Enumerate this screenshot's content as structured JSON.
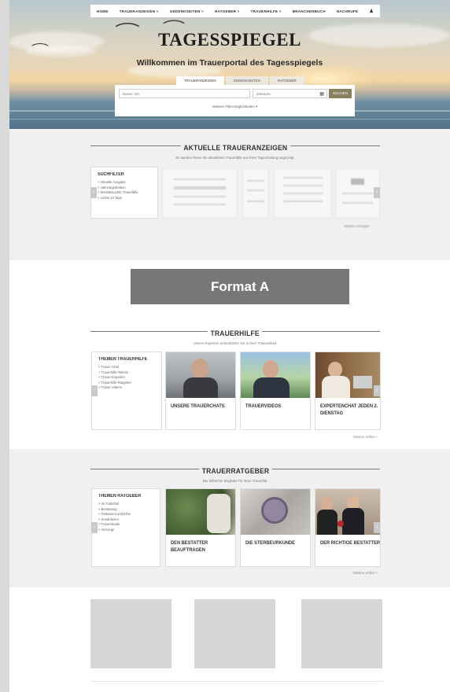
{
  "nav": {
    "items": [
      "HOME",
      "TRAUERANZEIGEN",
      "GEDENKSEITEN",
      "RATGEBER",
      "TRAUERHILFE",
      "BRANCHENBUCH",
      "NACHRUFE"
    ],
    "user_icon": "user-icon"
  },
  "hero": {
    "logo": "TAGESSPIEGEL",
    "welcome": "Willkommen im Trauerportal des Tagesspiegels",
    "tabs": [
      "TRAUERANZEIGEN",
      "GEDENKSEITEN",
      "RATGEBER"
    ],
    "name_placeholder": "Name, Ort",
    "period_placeholder": "Zeitraum",
    "search_label": "SUCHEN",
    "more_options": "Weitere Filtermöglichkeiten ▾"
  },
  "anzeigen": {
    "title": "AKTUELLE TRAUERANZEIGEN",
    "subtitle": "Es werden Ihnen die aktuellsten Trauerfälle aus Ihrer Tageszeitung angezeigt.",
    "filter_title": "SUCHFILTER",
    "filters": [
      "> Aktuelle Ausgabe",
      "> Jahrestgedenken",
      "> Meistbesuchte Trauerfälle",
      "> Letzte 14 Tage"
    ],
    "more": "Weitere Anzeigen"
  },
  "format": {
    "label": "Format A"
  },
  "trauerhilfe": {
    "title": "TRAUERHILFE",
    "subtitle": "Unsere Experten unterstützen Sie in Ihrer Trauerarbeit.",
    "filter_title": "THEMEN TRAUERHILFE",
    "items": [
      "> Trauer-Chat",
      "> Trauerhilfe-Telefon",
      "> Trauer-Experten",
      "> Trauerhilfe-Ratgeber",
      "> Trauer-Videos"
    ],
    "cards": [
      "UNSERE TRAUERCHATS",
      "TRAUERVIDEOS",
      "EXPERTENCHAT JEDEN 2. DIENSTAG"
    ],
    "more": "Weitere Artikel >"
  },
  "ratgeber": {
    "title": "TRAUERRATGEBER",
    "subtitle": "Der hilfreiche Begleiter für Ihren Trauerfall.",
    "filter_title": "THEMEN RATGEBER",
    "items": [
      "> Im Todesfall",
      "> Bestattung",
      "> Testament und Erbe",
      "> Kondolieren",
      "> Trauerrituale",
      "> Vorsorge"
    ],
    "cards": [
      "DEN BESTATTER BEAUFTRAGEN",
      "DIE STERBEURKUNDE",
      "DER RICHTIGE BESTATTER"
    ],
    "more": "Weitere Artikel >"
  },
  "colors": {
    "accent": "#8a7f5f",
    "format_bar": "#777777",
    "section_bg": "#f0f0f0"
  }
}
